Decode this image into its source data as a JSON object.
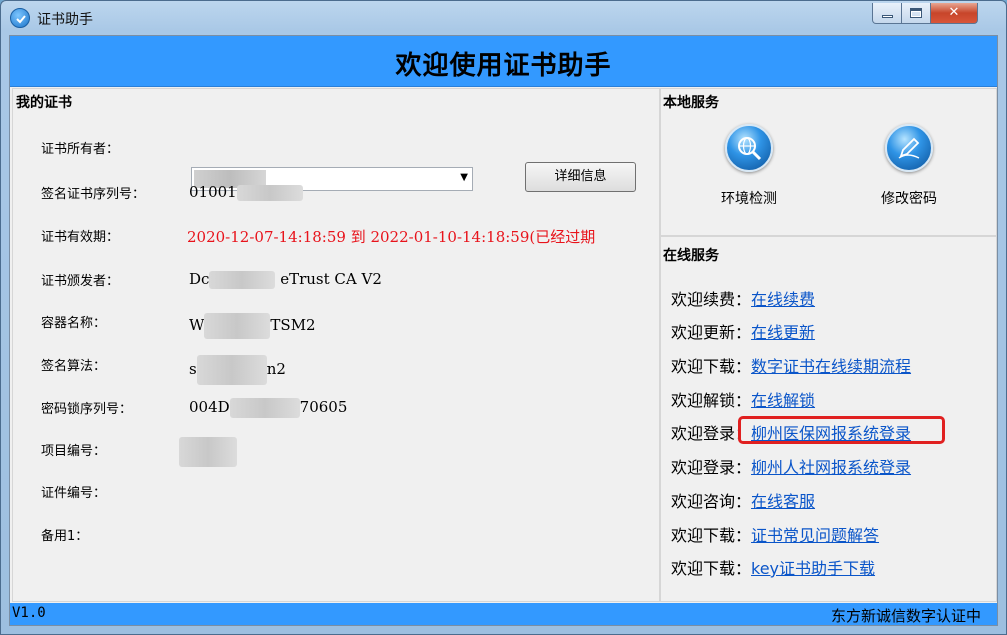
{
  "window": {
    "title": "证书助手"
  },
  "header": {
    "title": "欢迎使用证书助手"
  },
  "my_cert": {
    "section_title": "我的证书",
    "fields": [
      {
        "label": "证书所有者：",
        "value": ""
      },
      {
        "label": "签名证书序列号：",
        "value": "01001"
      },
      {
        "label": "证书有效期：",
        "value": "2020-12-07-14:18:59 到 2022-01-10-14:18:59(已经过期"
      },
      {
        "label": "证书颁发者：",
        "value_a": "Dc",
        "value_b": "eTrust CA V2"
      },
      {
        "label": "容器名称：",
        "value_a": "W",
        "value_b": "TSM2"
      },
      {
        "label": "签名算法：",
        "value_a": "s",
        "value_b": "n2"
      },
      {
        "label": "密码锁序列号：",
        "value_a": "004D",
        "value_b": "70605"
      },
      {
        "label": "项目编号：",
        "value": ""
      },
      {
        "label": "证件编号：",
        "value": ""
      },
      {
        "label": "备用1：",
        "value": ""
      }
    ],
    "detail_button": "详细信息"
  },
  "local_service": {
    "section_title": "本地服务",
    "items": [
      {
        "label": "环境检测",
        "icon": "globe-search-icon"
      },
      {
        "label": "修改密码",
        "icon": "pen-edit-icon"
      }
    ]
  },
  "online_service": {
    "section_title": "在线服务",
    "rows": [
      {
        "prefix": "欢迎续费：",
        "link": "在线续费"
      },
      {
        "prefix": "欢迎更新：",
        "link": "在线更新"
      },
      {
        "prefix": "欢迎下载：",
        "link": "数字证书在线续期流程"
      },
      {
        "prefix": "欢迎解锁：",
        "link": "在线解锁"
      },
      {
        "prefix": "欢迎登录：",
        "link": "柳州医保网报系统登录"
      },
      {
        "prefix": "欢迎登录：",
        "link": "柳州人社网报系统登录"
      },
      {
        "prefix": "欢迎咨询：",
        "link": "在线客服"
      },
      {
        "prefix": "欢迎下载：",
        "link": "证书常见问题解答"
      },
      {
        "prefix": "欢迎下载：",
        "link": "key证书助手下载"
      }
    ]
  },
  "status": {
    "version": "V1.0",
    "company": "东方新诚信数字认证中"
  },
  "colors": {
    "accent": "#3399ff",
    "link": "#0a55c9",
    "expired": "#e8131b",
    "highlight": "#e02020"
  }
}
